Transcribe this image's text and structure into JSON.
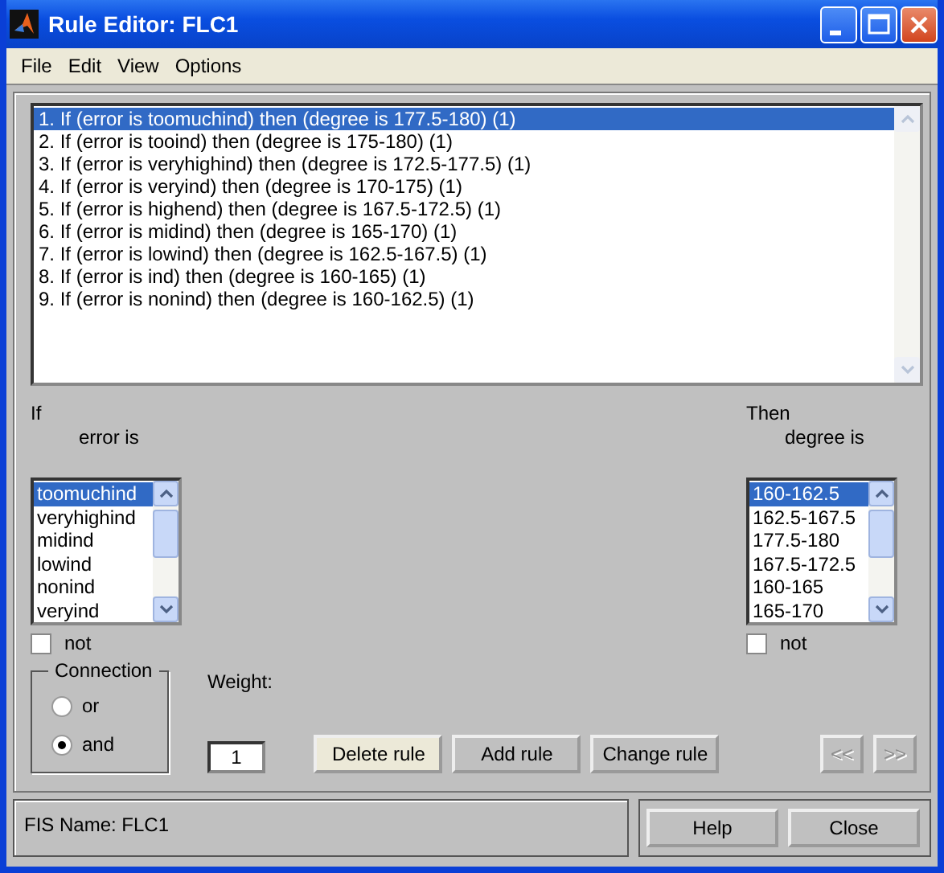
{
  "window": {
    "title": "Rule Editor: FLC1"
  },
  "menu": [
    "File",
    "Edit",
    "View",
    "Options"
  ],
  "rules": [
    {
      "text": "1. If (error is toomuchind) then (degree is 177.5-180) (1)",
      "selected": true
    },
    {
      "text": "2. If (error is tooind) then (degree is 175-180) (1)",
      "selected": false
    },
    {
      "text": "3. If (error is veryhighind) then (degree is 172.5-177.5) (1)",
      "selected": false
    },
    {
      "text": "4. If (error is veryind) then (degree is 170-175) (1)",
      "selected": false
    },
    {
      "text": "5. If (error is highend) then (degree is 167.5-172.5) (1)",
      "selected": false
    },
    {
      "text": "6. If (error is midind) then (degree is 165-170) (1)",
      "selected": false
    },
    {
      "text": "7. If (error is lowind) then (degree is 162.5-167.5) (1)",
      "selected": false
    },
    {
      "text": "8. If (error is ind) then (degree is 160-165) (1)",
      "selected": false
    },
    {
      "text": "9. If (error is nonind) then (degree is 160-162.5) (1)",
      "selected": false
    }
  ],
  "if_panel": {
    "heading": "If",
    "variable_label": "error is",
    "items": [
      {
        "text": "toomuchind",
        "selected": true
      },
      {
        "text": "veryhighind",
        "selected": false
      },
      {
        "text": "midind",
        "selected": false
      },
      {
        "text": "lowind",
        "selected": false
      },
      {
        "text": "nonind",
        "selected": false
      },
      {
        "text": "veryind",
        "selected": false
      }
    ],
    "not": {
      "label": "not",
      "checked": false
    }
  },
  "then_panel": {
    "heading": "Then",
    "variable_label": "degree is",
    "items": [
      {
        "text": "160-162.5",
        "selected": true
      },
      {
        "text": "162.5-167.5",
        "selected": false
      },
      {
        "text": "177.5-180",
        "selected": false
      },
      {
        "text": "167.5-172.5",
        "selected": false
      },
      {
        "text": "160-165",
        "selected": false
      },
      {
        "text": "165-170",
        "selected": false
      }
    ],
    "not": {
      "label": "not",
      "checked": false
    }
  },
  "connection": {
    "title": "Connection",
    "options": [
      {
        "label": "or",
        "selected": false
      },
      {
        "label": "and",
        "selected": true
      }
    ]
  },
  "weight": {
    "label": "Weight:",
    "value": "1"
  },
  "rule_buttons": [
    {
      "label": "Delete rule",
      "highlighted": true
    },
    {
      "label": "Add rule",
      "highlighted": false
    },
    {
      "label": "Change rule",
      "highlighted": false
    }
  ],
  "nav_buttons": [
    {
      "label": "<<",
      "disabled": true
    },
    {
      "label": ">>",
      "disabled": true
    }
  ],
  "status": "FIS Name: FLC1",
  "footer_buttons": [
    "Help",
    "Close"
  ]
}
